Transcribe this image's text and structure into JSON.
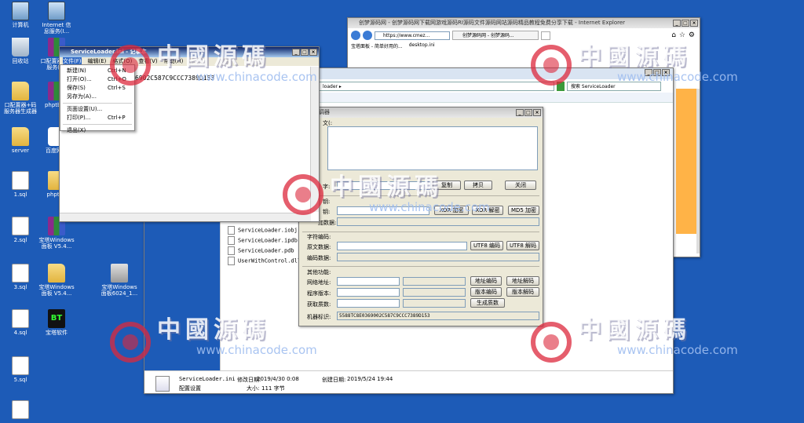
{
  "desktop_icons": [
    {
      "label": "计算机",
      "icon": "computer-icon",
      "type": "pc"
    },
    {
      "label": "Internet 信\n息服务(I...",
      "icon": "iis-icon",
      "type": "pc"
    },
    {
      "label": "回收站",
      "icon": "recycle-bin-icon",
      "type": "bin"
    },
    {
      "label": "口配置器+码\n服务(I...",
      "icon": "archive-icon",
      "type": "rar"
    },
    {
      "label": "口配置器+码\n服务器生成器",
      "icon": "folder-icon",
      "type": "folder"
    },
    {
      "label": "phptbb.r",
      "icon": "archive-icon",
      "type": "rar"
    },
    {
      "label": "server",
      "icon": "folder-icon",
      "type": "folder"
    },
    {
      "label": "百度网盘",
      "icon": "cloud-icon",
      "type": "cloud"
    },
    {
      "label": "1.sql",
      "icon": "document-icon",
      "type": "doc"
    },
    {
      "label": "phptbb",
      "icon": "folder-icon",
      "type": "folder"
    },
    {
      "label": "2.sql",
      "icon": "document-icon",
      "type": "doc"
    },
    {
      "label": "宝塔Windows\n面板 V5.4...",
      "icon": "archive-icon",
      "type": "rar"
    },
    {
      "label": "3.sql",
      "icon": "document-icon",
      "type": "doc"
    },
    {
      "label": "宝塔Windows\n面板 V5.4...",
      "icon": "folder-icon",
      "type": "folder"
    },
    {
      "label": "宝塔Windows\n面板6024_1...",
      "icon": "setup-icon",
      "type": "setup"
    },
    {
      "label": "4.sql",
      "icon": "document-icon",
      "type": "doc"
    },
    {
      "label": "宝塔软件",
      "icon": "bt-icon",
      "type": "bt"
    },
    {
      "label": "5.sql",
      "icon": "document-icon",
      "type": "doc"
    },
    {
      "label": "",
      "icon": "document-icon",
      "type": "doc"
    }
  ],
  "ie": {
    "title": "创梦源码网 - 创梦源码网下载网游戏源码RI源码文件源码网站源码精品教程免费分享下载 - Internet Explorer",
    "address": "https://www.cmez...",
    "tab_label": "创梦源码网 - 创梦源码...",
    "fav1": "宝塔面板 - 简单好用的...",
    "fav2": "desktop.ini"
  },
  "explorer": {
    "address": "loader ▸",
    "search_placeholder": "搜索 ServiceLoader",
    "files": [
      "ServiceLoader.iobj",
      "ServiceLoader.ipdb",
      "ServiceLoader.pdb",
      "UserWithControl.dll"
    ],
    "details": {
      "filename": "ServiceLoader.ini",
      "modified_label": "修改日期:",
      "modified": "2019/4/30 0:08",
      "created_label": "创建日期:",
      "created": "2019/5/24 19:44",
      "type": "配置设置",
      "size_label": "大小:",
      "size": "111 字节"
    }
  },
  "notepad": {
    "title": "ServiceLoader.ini - 记事本",
    "menu": [
      "文件(F)",
      "编辑(E)",
      "格式(O)",
      "查看(V)",
      "帮助(H)"
    ],
    "content": "6902C587C9CCC7389D153",
    "file_menu": [
      {
        "label": "新建(N)",
        "shortcut": "Ctrl+N"
      },
      {
        "label": "打开(O)...",
        "shortcut": "Ctrl+O"
      },
      {
        "label": "保存(S)",
        "shortcut": "Ctrl+S"
      },
      {
        "label": "另存为(A)...",
        "shortcut": ""
      },
      {
        "label": "页面设置(U)...",
        "shortcut": ""
      },
      {
        "label": "打印(P)...",
        "shortcut": "Ctrl+P"
      },
      {
        "label": "退出(X)",
        "shortcut": ""
      }
    ]
  },
  "tool": {
    "title": "主调器",
    "section_text": "文(:",
    "key_label": "字:",
    "btn_copy1": "复制",
    "btn_copy2": "拷贝",
    "btn_close": "关闭",
    "key2_label": "钥:",
    "key3_label": "钥:",
    "crypt_label": "加数据:",
    "btn_xor_enc": "XOR 加密",
    "btn_xor_dec": "XOR 解密",
    "btn_md5": "MD5 加密",
    "charset_group": "字符编码:",
    "raw_label": "原文数据:",
    "btn_utf8_enc": "UTF8 编码",
    "btn_utf8_dec": "UTF8 解码",
    "encoded_label": "编码数据:",
    "other_group": "其他功能:",
    "net_label": "网络地址:",
    "btn_addr_enc": "地址编码",
    "btn_addr_dec": "地址解码",
    "ver_label": "程序版本:",
    "btn_ver_enc": "版本编码",
    "btn_ver_dec": "版本解码",
    "prime_label": "获取质数:",
    "btn_prime": "生成质数",
    "machine_label": "机器标识:",
    "machine_id": "5588TC8E0369002C587C9CCC7389D153"
  },
  "watermark": {
    "cn": "中國源碼",
    "url": "www.chinacode.com"
  }
}
